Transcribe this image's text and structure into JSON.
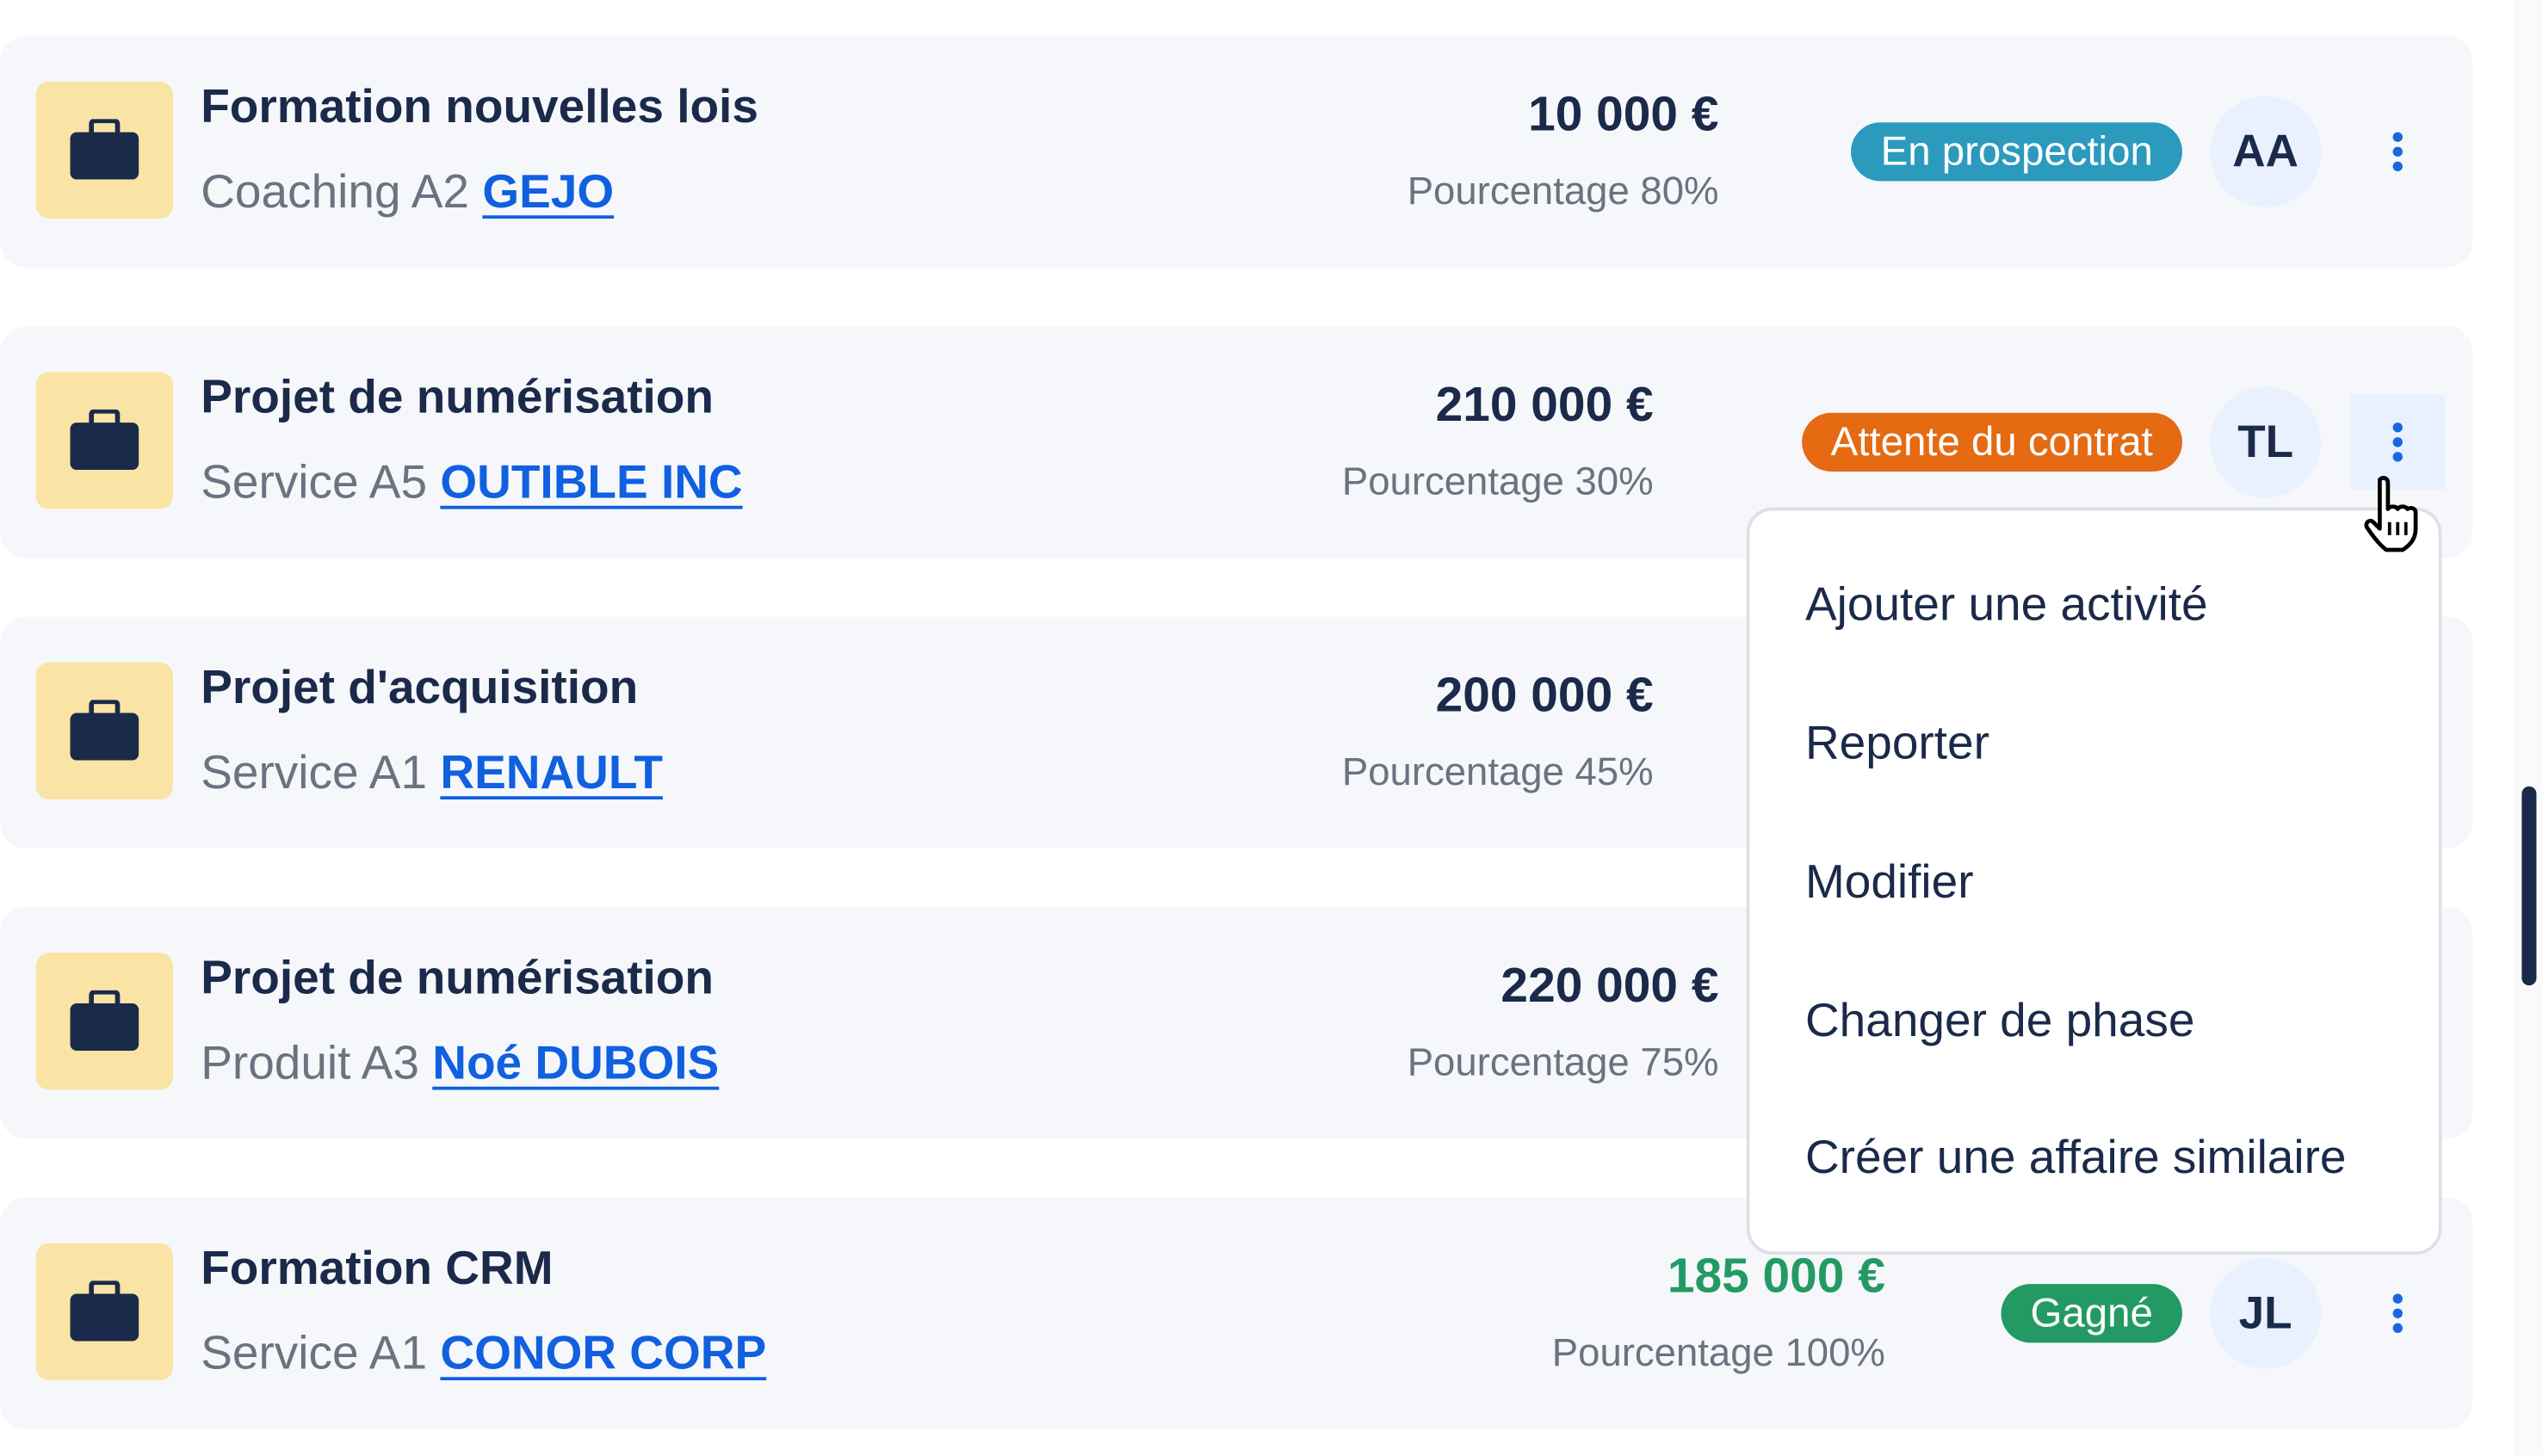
{
  "colors": {
    "card_bg": "#f5f7fa",
    "icon_bg": "#f9e4a5",
    "text": "#1b2a4a",
    "link": "#1060e0",
    "accent": "#1a66e0",
    "won": "#239a63"
  },
  "deals": [
    {
      "title": "Formation nouvelles lois",
      "subtitle": "Coaching A2",
      "client": "GEJO",
      "amount": "10 000 €",
      "percent": "Pourcentage 80%",
      "status": "En prospection",
      "status_color": "#2b9abd",
      "owner": "AA",
      "icon": "briefcase-icon"
    },
    {
      "title": "Projet de numérisation",
      "subtitle": "Service A5",
      "client": "OUTIBLE INC",
      "amount": "210 000 €",
      "percent": "Pourcentage 30%",
      "status": "Attente du contrat",
      "status_color": "#e56a12",
      "owner": "TL",
      "icon": "briefcase-icon"
    },
    {
      "title": "Projet d'acquisition",
      "subtitle": "Service A1",
      "client": "RENAULT",
      "amount": "200 000 €",
      "percent": "Pourcentage 45%",
      "status": "",
      "owner": "",
      "icon": "briefcase-icon"
    },
    {
      "title": "Projet de numérisation",
      "subtitle": "Produit A3",
      "client": "Noé DUBOIS",
      "amount": "220 000 €",
      "percent": "Pourcentage 75%",
      "status": "",
      "owner": "",
      "icon": "briefcase-icon"
    },
    {
      "title": "Formation CRM",
      "subtitle": "Service A1",
      "client": "CONOR CORP",
      "amount": "185 000 €",
      "percent": "Pourcentage 100%",
      "status": "Gagné",
      "status_color": "#239a63",
      "owner": "JL",
      "icon": "briefcase-icon"
    }
  ],
  "menu": {
    "items": [
      "Ajouter une activité",
      "Reporter",
      "Modifier",
      "Changer de phase",
      "Créer une affaire similaire"
    ]
  }
}
